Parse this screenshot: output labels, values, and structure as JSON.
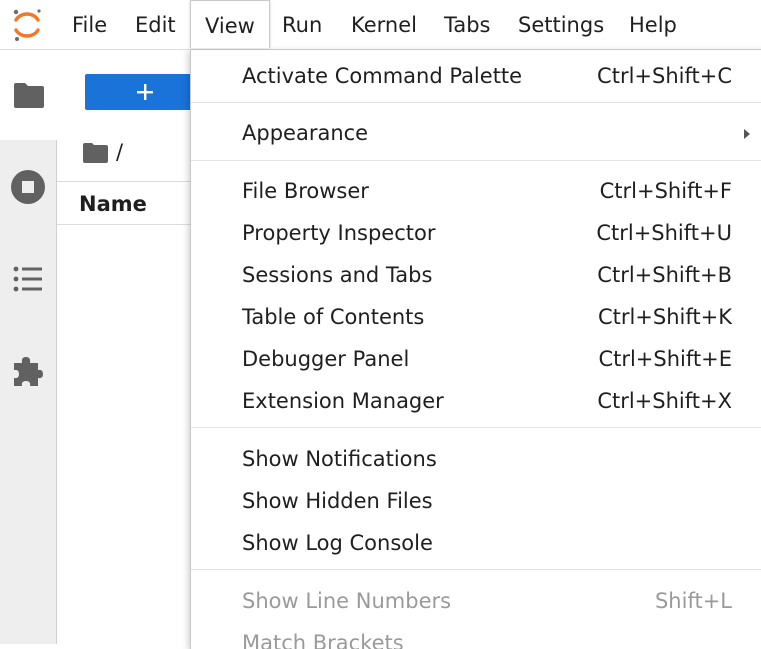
{
  "menubar": {
    "items": [
      {
        "label": "File"
      },
      {
        "label": "Edit"
      },
      {
        "label": "View"
      },
      {
        "label": "Run"
      },
      {
        "label": "Kernel"
      },
      {
        "label": "Tabs"
      },
      {
        "label": "Settings"
      },
      {
        "label": "Help"
      }
    ],
    "active": "View"
  },
  "activity_bar": {
    "tabs": [
      {
        "icon": "folder-icon",
        "selected": true
      },
      {
        "icon": "stop-circle-icon",
        "selected": false
      },
      {
        "icon": "list-icon",
        "selected": false
      },
      {
        "icon": "puzzle-icon",
        "selected": false
      }
    ]
  },
  "file_browser": {
    "new_button_icon": "plus-icon",
    "breadcrumb_path": "/",
    "column_header": "Name"
  },
  "view_menu": {
    "sections": [
      {
        "items": [
          {
            "label": "Activate Command Palette",
            "shortcut": "Ctrl+Shift+C"
          }
        ]
      },
      {
        "items": [
          {
            "label": "Appearance",
            "submenu": true
          }
        ]
      },
      {
        "items": [
          {
            "label": "File Browser",
            "shortcut": "Ctrl+Shift+F"
          },
          {
            "label": "Property Inspector",
            "shortcut": "Ctrl+Shift+U"
          },
          {
            "label": "Sessions and Tabs",
            "shortcut": "Ctrl+Shift+B"
          },
          {
            "label": "Table of Contents",
            "shortcut": "Ctrl+Shift+K"
          },
          {
            "label": "Debugger Panel",
            "shortcut": "Ctrl+Shift+E"
          },
          {
            "label": "Extension Manager",
            "shortcut": "Ctrl+Shift+X"
          }
        ]
      },
      {
        "items": [
          {
            "label": "Show Notifications"
          },
          {
            "label": "Show Hidden Files"
          },
          {
            "label": "Show Log Console"
          }
        ]
      },
      {
        "items": [
          {
            "label": "Show Line Numbers",
            "shortcut": "Shift+L",
            "disabled": true
          },
          {
            "label": "Match Brackets",
            "disabled": true
          }
        ]
      }
    ]
  },
  "colors": {
    "accent": "#1a73d9",
    "logo_orange": "#f37726",
    "icon_gray": "#616161",
    "disabled_text": "#9a9a9a"
  }
}
